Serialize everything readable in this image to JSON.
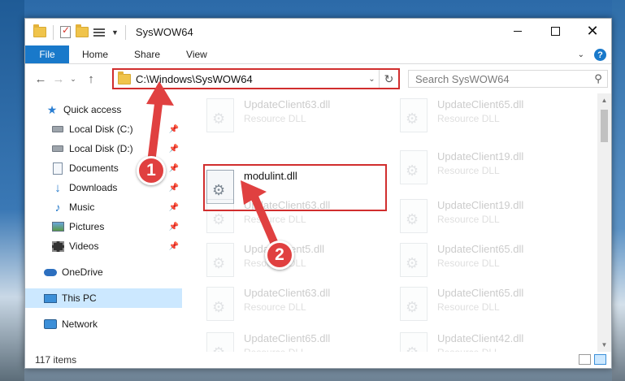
{
  "window": {
    "title": "SysWOW64"
  },
  "ribbon": {
    "tabs": [
      "File",
      "Home",
      "Share",
      "View"
    ]
  },
  "address": {
    "path": "C:\\Windows\\SysWOW64"
  },
  "search": {
    "placeholder": "Search SysWOW64"
  },
  "nav": {
    "quick_access": "Quick access",
    "items": [
      "Local Disk (C:)",
      "Local Disk (D:)",
      "Documents",
      "Downloads",
      "Music",
      "Pictures",
      "Videos"
    ],
    "onedrive": "OneDrive",
    "this_pc": "This PC",
    "network": "Network"
  },
  "files": [
    {
      "name": "UpdateClient63.dll",
      "type": "Resource DLL"
    },
    {
      "name": "UpdateClient65.dll",
      "type": "Resource DLL"
    },
    {
      "name": "modulint.dll",
      "type": ""
    },
    {
      "name": "UpdateClient19.dll",
      "type": "Resource DLL"
    },
    {
      "name": "UpdateClient63.dll",
      "type": "Resource DLL"
    },
    {
      "name": "UpdateClient19.dll",
      "type": "Resource DLL"
    },
    {
      "name": "UpdateClient5.dll",
      "type": "Resource DLL"
    },
    {
      "name": "UpdateClient65.dll",
      "type": "Resource DLL"
    },
    {
      "name": "UpdateClient63.dll",
      "type": "Resource DLL"
    },
    {
      "name": "UpdateClient65.dll",
      "type": "Resource DLL"
    },
    {
      "name": "UpdateClient65.dll",
      "type": "Resource DLL"
    },
    {
      "name": "UpdateClient42.dll",
      "type": "Resource DLL"
    }
  ],
  "status": {
    "items_count": "117 items"
  },
  "annotations": {
    "badge1": "1",
    "badge2": "2"
  },
  "colors": {
    "accent": "#1979ca",
    "annotation_red": "#d12e2e",
    "badge_red": "#e04040",
    "selection": "#cce8ff"
  }
}
